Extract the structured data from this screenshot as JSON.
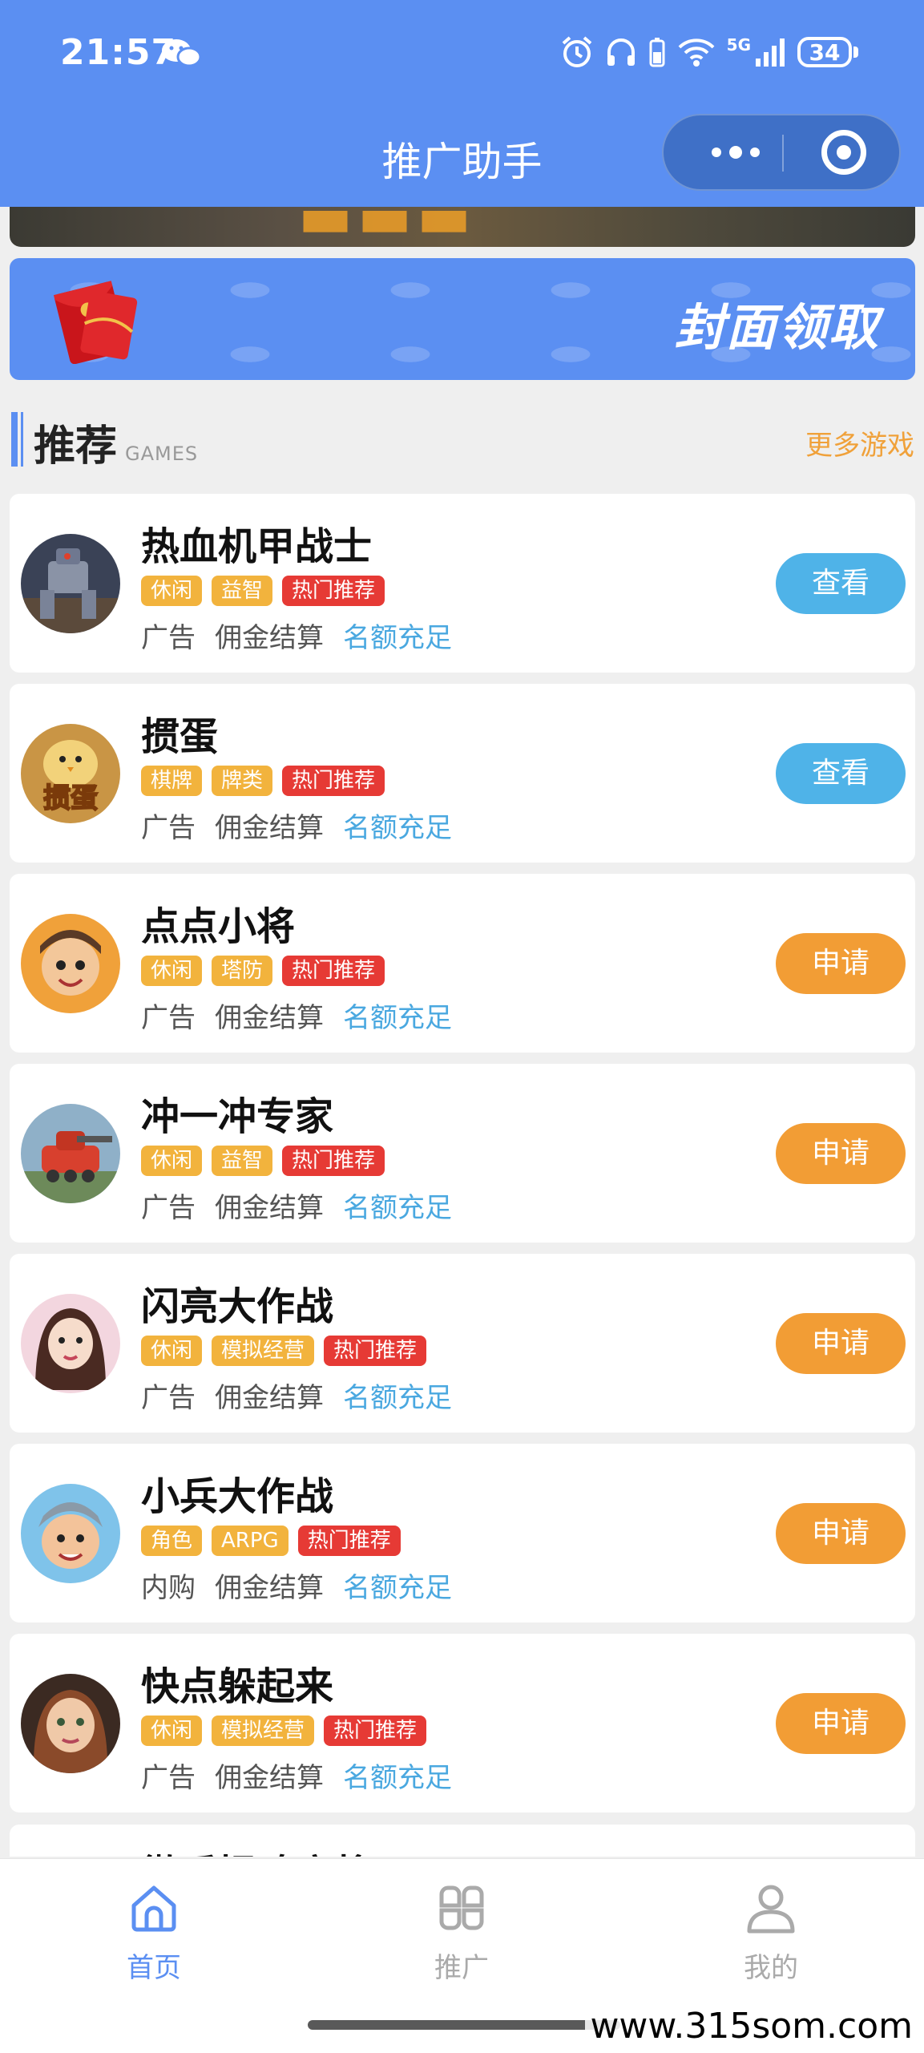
{
  "status_bar": {
    "time": "21:57",
    "network": "5G",
    "battery": "34"
  },
  "navbar": {
    "title": "推广助手"
  },
  "banner": {
    "cover_label": "封面领取"
  },
  "section": {
    "title": "推荐",
    "subtitle": "GAMES",
    "more": "更多游戏"
  },
  "games": [
    {
      "name": "热血机甲战士",
      "tags": [
        "休闲",
        "益智",
        "热门推荐"
      ],
      "meta": [
        "广告",
        "佣金结算",
        "名额充足"
      ],
      "button": "查看"
    },
    {
      "name": "掼蛋",
      "tags": [
        "棋牌",
        "牌类",
        "热门推荐"
      ],
      "meta": [
        "广告",
        "佣金结算",
        "名额充足"
      ],
      "button": "查看"
    },
    {
      "name": "点点小将",
      "tags": [
        "休闲",
        "塔防",
        "热门推荐"
      ],
      "meta": [
        "广告",
        "佣金结算",
        "名额充足"
      ],
      "button": "申请"
    },
    {
      "name": "冲一冲专家",
      "tags": [
        "休闲",
        "益智",
        "热门推荐"
      ],
      "meta": [
        "广告",
        "佣金结算",
        "名额充足"
      ],
      "button": "申请"
    },
    {
      "name": "闪亮大作战",
      "tags": [
        "休闲",
        "模拟经营",
        "热门推荐"
      ],
      "meta": [
        "广告",
        "佣金结算",
        "名额充足"
      ],
      "button": "申请"
    },
    {
      "name": "小兵大作战",
      "tags": [
        "角色",
        "ARPG",
        "热门推荐"
      ],
      "meta": [
        "内购",
        "佣金结算",
        "名额充足"
      ],
      "button": "申请"
    },
    {
      "name": "快点躲起来",
      "tags": [
        "休闲",
        "模拟经营",
        "热门推荐"
      ],
      "meta": [
        "广告",
        "佣金结算",
        "名额充足"
      ],
      "button": "申请"
    }
  ],
  "partial_game_name": "微乐捉鸡麻将",
  "tabbar": {
    "items": [
      {
        "label": "首页",
        "icon": "home-icon",
        "active": true
      },
      {
        "label": "推广",
        "icon": "grid-icon",
        "active": false
      },
      {
        "label": "我的",
        "icon": "user-icon",
        "active": false
      }
    ]
  },
  "watermark": "www.315som.com",
  "colors": {
    "primary": "#5b8ff2",
    "view_button": "#4fb3e8",
    "apply_button": "#f29d35",
    "tag": "#f2b33d",
    "hot_tag": "#e63a35",
    "quota": "#4aa8e0",
    "more": "#f0a13a"
  }
}
